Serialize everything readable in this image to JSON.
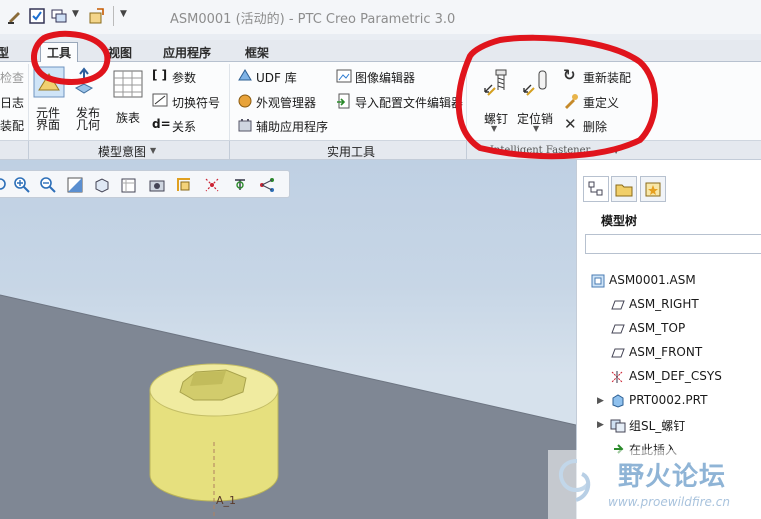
{
  "window": {
    "title": "ASM0001 (活动的) - PTC Creo Parametric 3.0"
  },
  "tabs": [
    {
      "label": "模型"
    },
    {
      "label": "工具",
      "active": true
    },
    {
      "label": "视图"
    },
    {
      "label": "应用程序"
    },
    {
      "label": "框架"
    }
  ],
  "ribbon": {
    "left_partial": {
      "check": "检查",
      "log": "日志",
      "assembly": "装配"
    },
    "model_intent": {
      "title": "模型意图",
      "component_interface": "元件\n界面",
      "publish_geometry": "发布\n几何",
      "family_table": "族表",
      "parameters": "参数",
      "switch_symbol": "切换符号",
      "relations": "关系"
    },
    "utilities": {
      "title": "实用工具",
      "udf_library": "UDF 库",
      "appearance_manager": "外观管理器",
      "aux_applications": "辅助应用程序",
      "image_editor": "图像编辑器",
      "import_config_editor": "导入配置文件编辑器"
    },
    "fastener": {
      "title": "Intelligent Fastener",
      "screw": "螺钉",
      "pin": "定位销",
      "reassemble": "重新装配",
      "redefine": "重定义",
      "delete": "删除"
    }
  },
  "panel": {
    "title": "模型树",
    "search_placeholder": "",
    "tree": [
      {
        "label": "ASM0001.ASM",
        "icon": "assembly-icon",
        "indent": 0
      },
      {
        "label": "ASM_RIGHT",
        "icon": "datum-plane-icon",
        "indent": 1
      },
      {
        "label": "ASM_TOP",
        "icon": "datum-plane-icon",
        "indent": 1
      },
      {
        "label": "ASM_FRONT",
        "icon": "datum-plane-icon",
        "indent": 1
      },
      {
        "label": "ASM_DEF_CSYS",
        "icon": "csys-icon",
        "indent": 1
      },
      {
        "label": "PRT0002.PRT",
        "icon": "part-icon",
        "indent": 1,
        "expandable": true
      },
      {
        "label": "组SL_螺钉",
        "icon": "group-icon",
        "indent": 1,
        "expandable": true
      },
      {
        "label": "在此插入",
        "icon": "insert-here-icon",
        "indent": 1
      }
    ]
  },
  "viewport": {
    "axis_label": "A_1"
  },
  "watermark": {
    "brand": "野火论坛",
    "url": "www.proewildfire.cn"
  },
  "colors": {
    "highlight_red": "#e0141c",
    "part_yellow": "#e9e38a",
    "arrow_green": "#2b8a2b"
  }
}
